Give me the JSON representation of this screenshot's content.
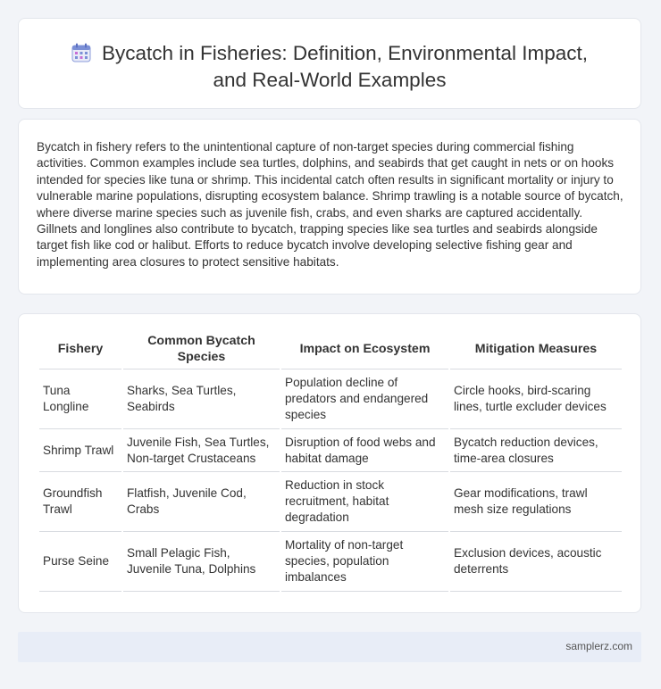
{
  "header": {
    "icon": "calendar-icon",
    "title_line1": "Bycatch in Fisheries: Definition, Environmental Impact,",
    "title_line2": "and Real-World Examples"
  },
  "intro": {
    "text": "Bycatch in fishery refers to the unintentional capture of non-target species during commercial fishing activities. Common examples include sea turtles, dolphins, and seabirds that get caught in nets or on hooks intended for species like tuna or shrimp. This incidental catch often results in significant mortality or injury to vulnerable marine populations, disrupting ecosystem balance. Shrimp trawling is a notable source of bycatch, where diverse marine species such as juvenile fish, crabs, and even sharks are captured accidentally. Gillnets and longlines also contribute to bycatch, trapping species like sea turtles and seabirds alongside target fish like cod or halibut. Efforts to reduce bycatch involve developing selective fishing gear and implementing area closures to protect sensitive habitats."
  },
  "table": {
    "headers": [
      "Fishery",
      "Common Bycatch Species",
      "Impact on Ecosystem",
      "Mitigation Measures"
    ],
    "rows": [
      [
        "Tuna Longline",
        "Sharks, Sea Turtles, Seabirds",
        "Population decline of predators and endangered species",
        "Circle hooks, bird-scaring lines, turtle excluder devices"
      ],
      [
        "Shrimp Trawl",
        "Juvenile Fish, Sea Turtles, Non-target Crustaceans",
        "Disruption of food webs and habitat damage",
        "Bycatch reduction devices, time-area closures"
      ],
      [
        "Groundfish Trawl",
        "Flatfish, Juvenile Cod, Crabs",
        "Reduction in stock recruitment, habitat degradation",
        "Gear modifications, trawl mesh size regulations"
      ],
      [
        "Purse Seine",
        "Small Pelagic Fish, Juvenile Tuna, Dolphins",
        "Mortality of non-target species, population imbalances",
        "Exclusion devices, acoustic deterrents"
      ]
    ]
  },
  "footer": {
    "site": "samplerz.com"
  },
  "colors": {
    "accent": "#7b8fd6",
    "footer_bg": "#e8edf7"
  }
}
